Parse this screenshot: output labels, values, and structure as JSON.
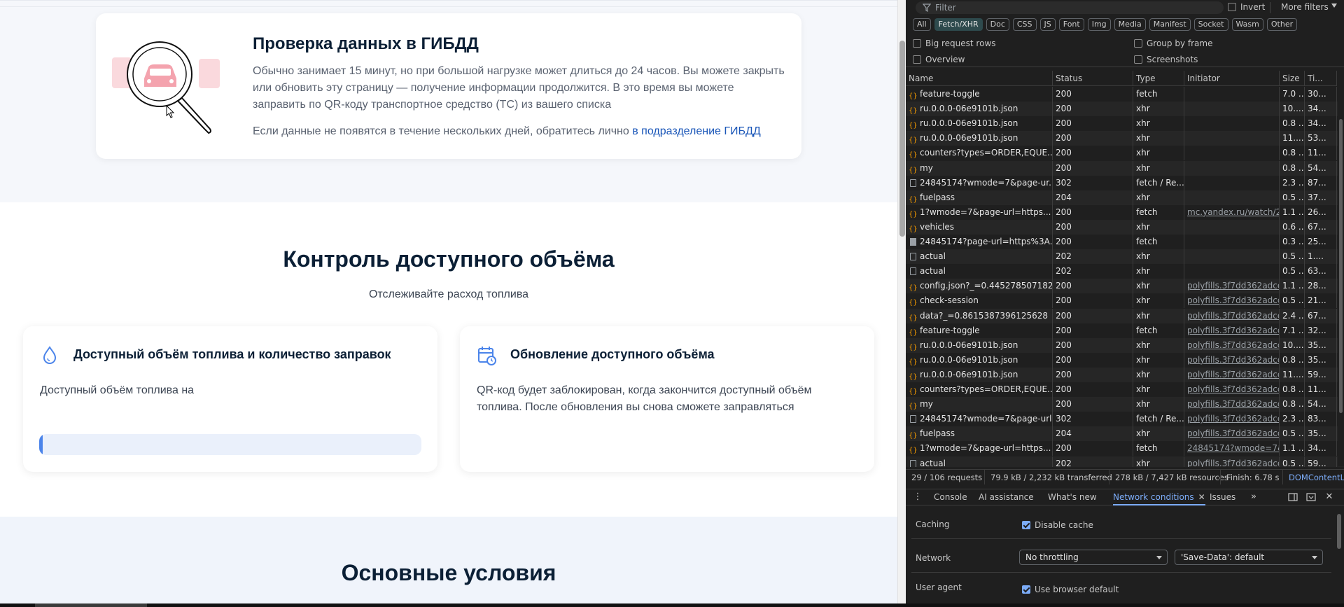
{
  "page": {
    "gibdd": {
      "title": "Проверка данных в ГИБДД",
      "text": "Обычно занимает 15 минут, но при большой нагрузке может длиться до 24 часов. Вы можете закрыть или обновить эту страницу — получение информации продолжится. В это время вы можете заправить по QR-коду транспортное средство (ТС) из вашего списка",
      "text2_prefix": "Если данные не появятся в течение нескольких дней, обратитесь лично ",
      "text2_link": "в подразделение ГИБДД"
    },
    "control": {
      "title": "Контроль доступного объёма",
      "subtitle": "Отслеживайте расход топлива"
    },
    "card_volume": {
      "icon": "drop-icon",
      "title": "Доступный объём топлива и количество заправок",
      "text": "Доступный объём топлива на",
      "progress": 0.01
    },
    "card_update": {
      "icon": "calendar-clock-icon",
      "title": "Обновление доступного объёма",
      "text": "QR-код будет заблокирован, когда закончится доступный объём топлива. После обновления вы снова сможете заправляться"
    },
    "conditions": {
      "title": "Основные условия"
    },
    "colors": {
      "accent": "#4b84ea",
      "link": "#1a56b8",
      "heading": "#0b1f35"
    }
  },
  "devtools": {
    "filter_placeholder": "Filter",
    "invert_label": "Invert",
    "more_filters": "More filters",
    "types": [
      "All",
      "Fetch/XHR",
      "Doc",
      "CSS",
      "JS",
      "Font",
      "Img",
      "Media",
      "Manifest",
      "Socket",
      "Wasm",
      "Other"
    ],
    "active_type": "Fetch/XHR",
    "options": {
      "big_rows": "Big request rows",
      "group_by_frame": "Group by frame",
      "overview": "Overview",
      "screenshots": "Screenshots"
    },
    "columns": [
      "Name",
      "Status",
      "Type",
      "Initiator",
      "Size",
      "Ti..."
    ],
    "rows": [
      {
        "icon": "xhr",
        "name": "feature-toggle",
        "status": "200",
        "type": "fetch",
        "initiator": "",
        "size": "7.0 ...",
        "time": "30..."
      },
      {
        "icon": "xhr",
        "name": "ru.0.0.0-06e9101b.json",
        "status": "200",
        "type": "xhr",
        "initiator": "",
        "size": "10....",
        "time": "34..."
      },
      {
        "icon": "xhr",
        "name": "ru.0.0.0-06e9101b.json",
        "status": "200",
        "type": "xhr",
        "initiator": "",
        "size": "0.8 ...",
        "time": "34..."
      },
      {
        "icon": "xhr",
        "name": "ru.0.0.0-06e9101b.json",
        "status": "200",
        "type": "xhr",
        "initiator": "",
        "size": "11....",
        "time": "53..."
      },
      {
        "icon": "xhr",
        "name": "counters?types=ORDER,EQUE...",
        "status": "200",
        "type": "xhr",
        "initiator": "",
        "size": "0.8 ...",
        "time": "11..."
      },
      {
        "icon": "xhr",
        "name": "my",
        "status": "200",
        "type": "xhr",
        "initiator": "",
        "size": "0.8 ...",
        "time": "54..."
      },
      {
        "icon": "doc",
        "name": "24845174?wmode=7&page-ur...",
        "status": "302",
        "type": "fetch / Re...",
        "initiator": "",
        "size": "2.3 ...",
        "time": "87..."
      },
      {
        "icon": "xhr",
        "name": "fuelpass",
        "status": "204",
        "type": "xhr",
        "initiator": "",
        "size": "0.5 ...",
        "time": "37..."
      },
      {
        "icon": "xhr",
        "name": "1?wmode=7&page-url=https...",
        "status": "200",
        "type": "fetch",
        "initiator": "mc.yandex.ru/watch/2",
        "size": "1.1 ...",
        "time": "26..."
      },
      {
        "icon": "xhr",
        "name": "vehicles",
        "status": "200",
        "type": "xhr",
        "initiator": "",
        "size": "0.6 ...",
        "time": "67..."
      },
      {
        "icon": "img",
        "name": "24845174?page-url=https%3A...",
        "status": "200",
        "type": "fetch",
        "initiator": "",
        "size": "0.3 ...",
        "time": "25..."
      },
      {
        "icon": "doc",
        "name": "actual",
        "status": "202",
        "type": "xhr",
        "initiator": "",
        "size": "0.5 ...",
        "time": "1...."
      },
      {
        "icon": "doc",
        "name": "actual",
        "status": "202",
        "type": "xhr",
        "initiator": "",
        "size": "0.5 ...",
        "time": "63..."
      },
      {
        "icon": "xhr",
        "name": "config.json?_=0.445278507182...",
        "status": "200",
        "type": "xhr",
        "initiator": "polyfills.3f7dd362adcc",
        "size": "1.1 ...",
        "time": "28..."
      },
      {
        "icon": "xhr",
        "name": "check-session",
        "status": "200",
        "type": "xhr",
        "initiator": "polyfills.3f7dd362adcc",
        "size": "0.5 ...",
        "time": "21..."
      },
      {
        "icon": "xhr",
        "name": "data?_=0.8615387396125628",
        "status": "200",
        "type": "xhr",
        "initiator": "polyfills.3f7dd362adcc",
        "size": "2.4 ...",
        "time": "67..."
      },
      {
        "icon": "xhr",
        "name": "feature-toggle",
        "status": "200",
        "type": "fetch",
        "initiator": "polyfills.3f7dd362adcc",
        "size": "7.1 ...",
        "time": "32..."
      },
      {
        "icon": "xhr",
        "name": "ru.0.0.0-06e9101b.json",
        "status": "200",
        "type": "xhr",
        "initiator": "polyfills.3f7dd362adcc",
        "size": "10....",
        "time": "35..."
      },
      {
        "icon": "xhr",
        "name": "ru.0.0.0-06e9101b.json",
        "status": "200",
        "type": "xhr",
        "initiator": "polyfills.3f7dd362adcc",
        "size": "0.8 ...",
        "time": "35..."
      },
      {
        "icon": "xhr",
        "name": "ru.0.0.0-06e9101b.json",
        "status": "200",
        "type": "xhr",
        "initiator": "polyfills.3f7dd362adcc",
        "size": "11....",
        "time": "59..."
      },
      {
        "icon": "xhr",
        "name": "counters?types=ORDER,EQUE...",
        "status": "200",
        "type": "xhr",
        "initiator": "polyfills.3f7dd362adcc",
        "size": "0.8 ...",
        "time": "11..."
      },
      {
        "icon": "xhr",
        "name": "my",
        "status": "200",
        "type": "xhr",
        "initiator": "polyfills.3f7dd362adcc",
        "size": "0.8 ...",
        "time": "54..."
      },
      {
        "icon": "doc",
        "name": "24845174?wmode=7&page-url...",
        "status": "302",
        "type": "fetch / Re...",
        "initiator": "polyfills.3f7dd362adcc",
        "size": "2.3 ...",
        "time": "83..."
      },
      {
        "icon": "xhr",
        "name": "fuelpass",
        "status": "204",
        "type": "xhr",
        "initiator": "polyfills.3f7dd362adcc",
        "size": "0.5 ...",
        "time": "35..."
      },
      {
        "icon": "xhr",
        "name": "1?wmode=7&page-url=https...",
        "status": "200",
        "type": "fetch",
        "initiator": "24845174?wmode=7&",
        "size": "1.1 ...",
        "time": "34..."
      },
      {
        "icon": "doc",
        "name": "actual",
        "status": "202",
        "type": "xhr",
        "initiator": "polyfills.3f7dd362adcc",
        "size": "0.5 ...",
        "time": "59..."
      }
    ],
    "status_bar": {
      "requests": "29 / 106 requests",
      "transferred": "79.9 kB / 2,232 kB transferred",
      "resources": "278 kB / 7,427 kB resources",
      "finish": "Finish: 6.78 s",
      "dom": "DOMContentL"
    },
    "drawer_tabs": [
      "Console",
      "AI assistance",
      "What's new",
      "Network conditions",
      "Issues"
    ],
    "active_drawer_tab": "Network conditions",
    "network_conditions": {
      "caching_label": "Caching",
      "disable_cache": "Disable cache",
      "network_label": "Network",
      "throttling": "No throttling",
      "save_data": "'Save-Data': default",
      "user_agent_label": "User agent",
      "use_browser_default": "Use browser default"
    },
    "colors": {
      "background": "#1f1f1f",
      "active_tab": "#7cacf8",
      "xhr_icon": "#f29900"
    }
  }
}
